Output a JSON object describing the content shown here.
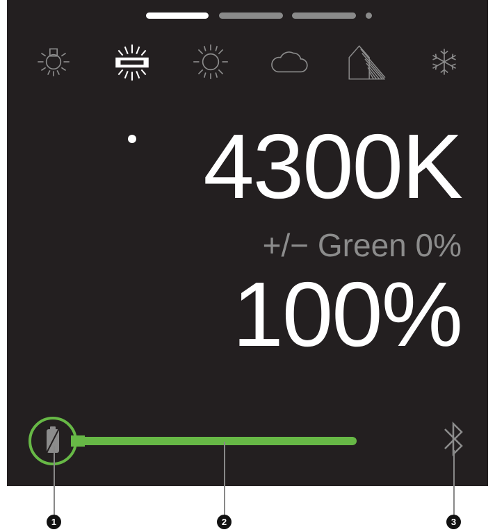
{
  "pager": {
    "pages": 4,
    "active_index": 0
  },
  "modes": [
    {
      "icon": "bulb-icon",
      "selected": false
    },
    {
      "icon": "fluorescent-tube-icon",
      "selected": true
    },
    {
      "icon": "sun-icon",
      "selected": false
    },
    {
      "icon": "cloud-icon",
      "selected": false
    },
    {
      "icon": "shade-icon",
      "selected": false
    },
    {
      "icon": "snowflake-icon",
      "selected": false
    }
  ],
  "readout": {
    "color_temperature": "4300K",
    "green_shift": "+/− Green 0%",
    "intensity": "100%"
  },
  "battery": {
    "level_fraction": 0.84
  },
  "callouts": [
    "1",
    "2",
    "3"
  ],
  "colors": {
    "background": "#231f20",
    "accent": "#67b846",
    "text": "#ffffff",
    "muted": "#8c8c8c"
  }
}
